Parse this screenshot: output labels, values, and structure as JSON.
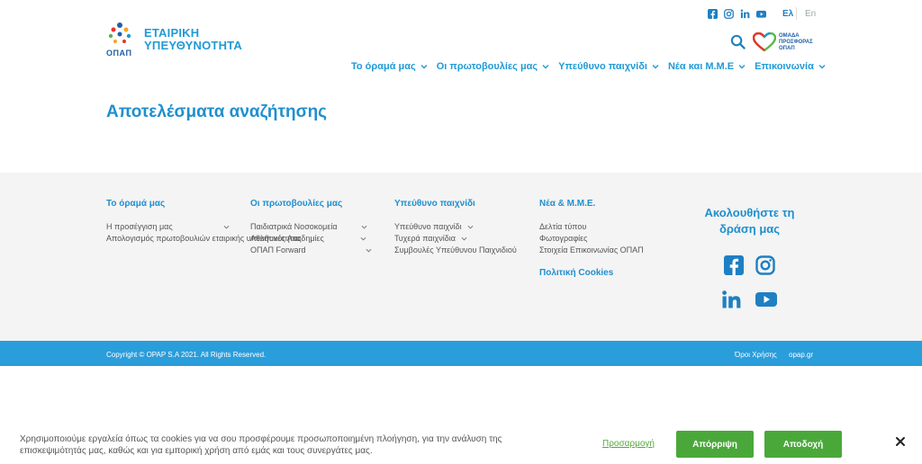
{
  "header": {
    "logo": {
      "line1": "ΕΤΑΙΡΙΚΗ",
      "line2": "ΥΠΕΥΘΥΝΟΤΗΤΑ",
      "brand": "ΟΠΑΠ"
    },
    "languages": {
      "el": "Ελ",
      "en": "En"
    },
    "team_logo": {
      "line1": "ΟΜΑΔΑ",
      "line2": "ΠΡΟΣΦΟΡΑΣ",
      "line3": "ΟΠΑΠ"
    },
    "nav": [
      {
        "label": "Το όραμά μας"
      },
      {
        "label": "Οι πρωτοβουλίες μας"
      },
      {
        "label": "Υπεύθυνο παιχνίδι"
      },
      {
        "label": "Νέα και Μ.Μ.Ε"
      },
      {
        "label": "Επικοινωνία"
      }
    ]
  },
  "page": {
    "title": "Αποτελέσματα αναζήτησης"
  },
  "footer": {
    "columns": [
      {
        "title": "Το όραμά μας",
        "links": [
          "Η προσέγγιση μας",
          "Απολογισμός πρωτοβουλιών εταιρικής υπευθυνότητας"
        ]
      },
      {
        "title": "Οι πρωτοβουλίες μας",
        "links": [
          "Παιδιατρικά Νοσοκομεία",
          "Αθλητικές Ακαδημίες",
          "ΟΠΑΠ Forward"
        ]
      },
      {
        "title": "Υπεύθυνο παιχνίδι",
        "links": [
          "Υπεύθυνο παιχνίδι",
          "Τυχερά παιχνίδια",
          "Συμβουλές Υπεύθυνου Παιχνιδιού"
        ]
      },
      {
        "title": "Νέα & Μ.Μ.Ε.",
        "links": [
          "Δελτία τύπου",
          "Φωτογραφίες",
          "Στοιχεία Επικοινωνίας ΟΠΑΠ"
        ],
        "extra": "Πολιτική Cookies"
      }
    ],
    "follow": {
      "line1": "Ακολουθήστε τη",
      "line2": "δράση μας"
    },
    "copyright": "Copyright © OPAP S.A 2021. All Rights Reserved.",
    "terms": "Όροι Χρήσης",
    "site": "opap.gr"
  },
  "cookie": {
    "text": "Χρησιμοποιούμε εργαλεία όπως τα cookies για να σου προσφέρουμε προσωποποιημένη πλοήγηση, για την ανάλυση της επισκεψιμότητάς μας, καθώς και για εμπορική χρήση από εμάς και τους συνεργάτες μας.",
    "customize": "Προσαρμογή",
    "reject": "Απόρριψη",
    "accept": "Αποδοχή"
  },
  "colors": {
    "brand_blue": "#1f8fcf",
    "bar_blue": "#2a9ddb",
    "green": "#4aa83a"
  },
  "icons": [
    "facebook-icon",
    "instagram-icon",
    "linkedin-icon",
    "youtube-icon",
    "search-icon",
    "chevron-down-icon",
    "close-icon"
  ]
}
